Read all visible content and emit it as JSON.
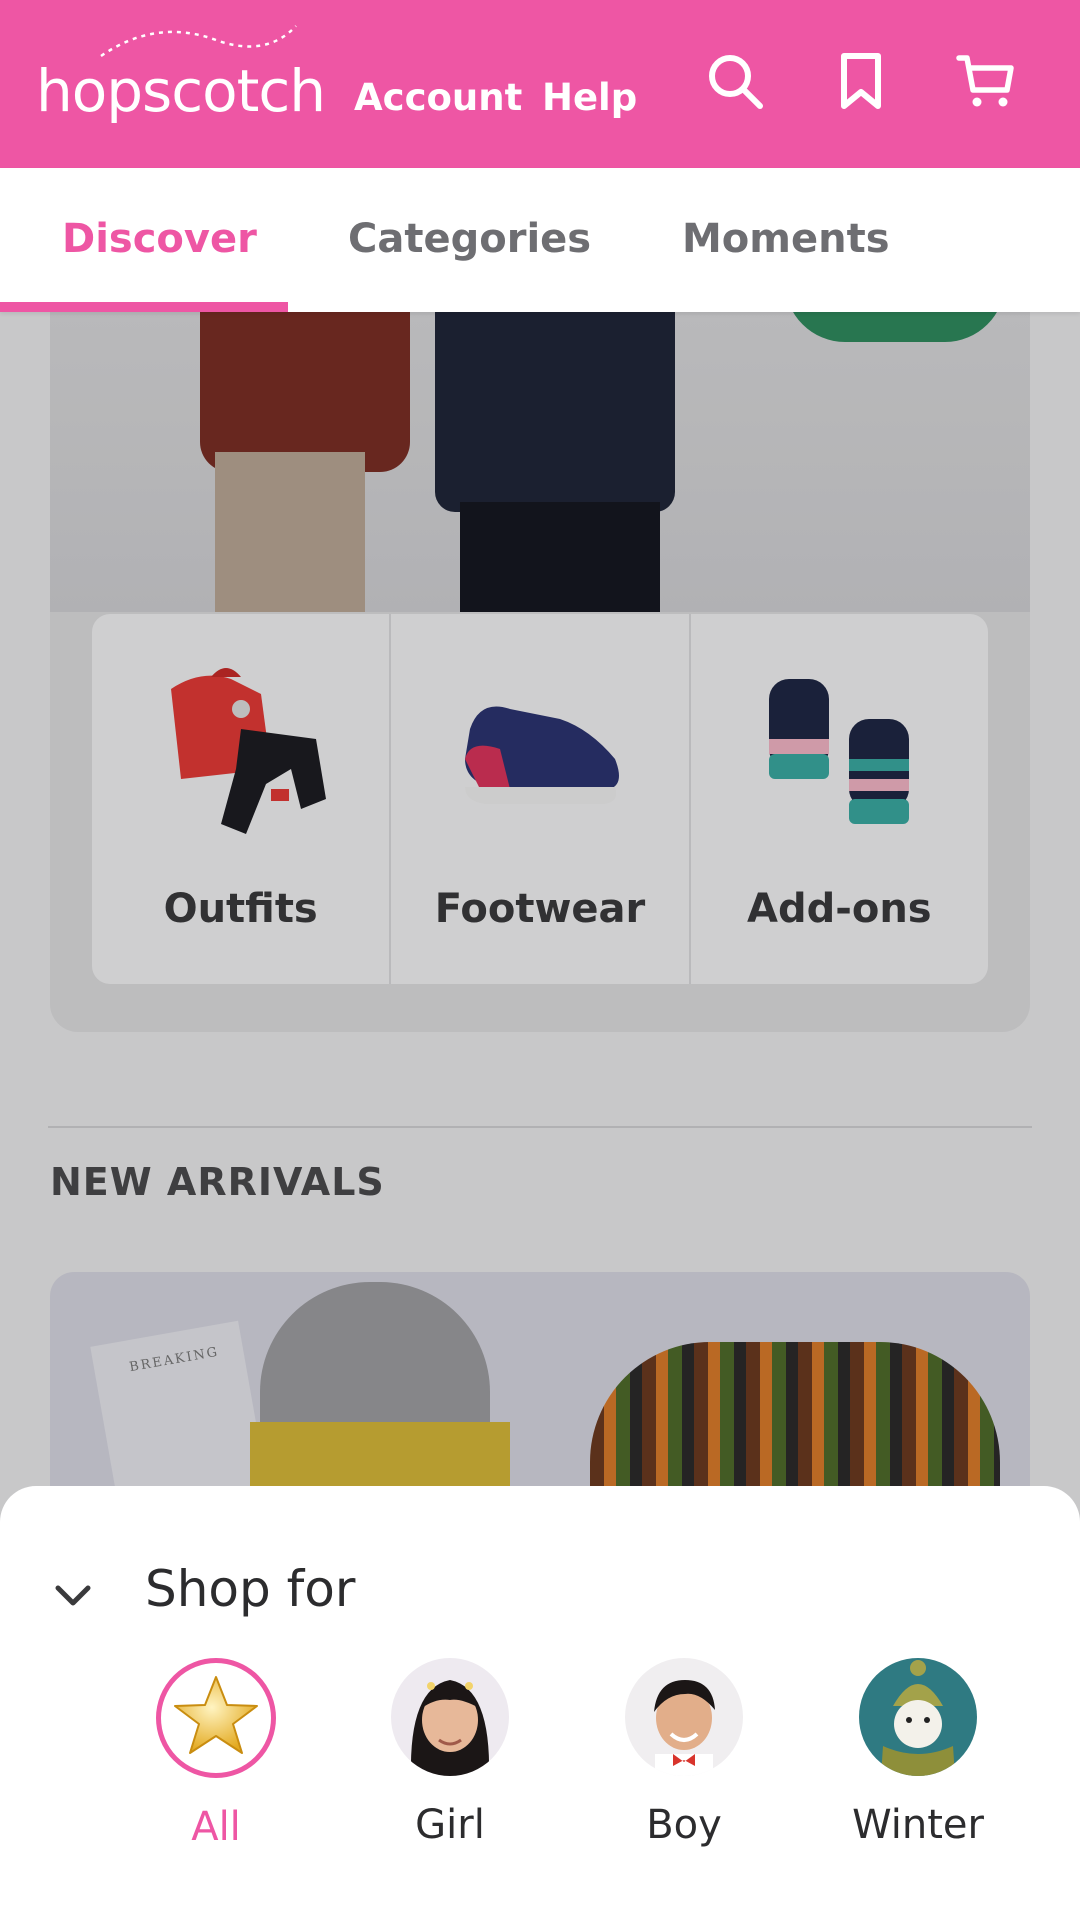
{
  "header": {
    "logo_text": "hopscotch",
    "links": [
      "Account",
      "Help"
    ],
    "icons": [
      "search-icon",
      "bookmark-icon",
      "cart-icon"
    ],
    "color": "#ee56a4"
  },
  "tabs": [
    {
      "label": "Discover",
      "active": true
    },
    {
      "label": "Categories",
      "active": false
    },
    {
      "label": "Moments",
      "active": false
    }
  ],
  "categories": [
    {
      "label": "Outfits",
      "icon": "outfit-image"
    },
    {
      "label": "Footwear",
      "icon": "shoe-image"
    },
    {
      "label": "Add-ons",
      "icon": "gloves-image"
    }
  ],
  "new_arrivals": {
    "title": "NEW ARRIVALS",
    "booklet_text": "BREAKING"
  },
  "shop_for": {
    "title": "Shop for",
    "items": [
      {
        "label": "All",
        "active": true,
        "icon": "star-icon"
      },
      {
        "label": "Girl",
        "active": false,
        "icon": "girl-avatar"
      },
      {
        "label": "Boy",
        "active": false,
        "icon": "boy-avatar"
      },
      {
        "label": "Winter",
        "active": false,
        "icon": "snowman-avatar"
      }
    ]
  }
}
